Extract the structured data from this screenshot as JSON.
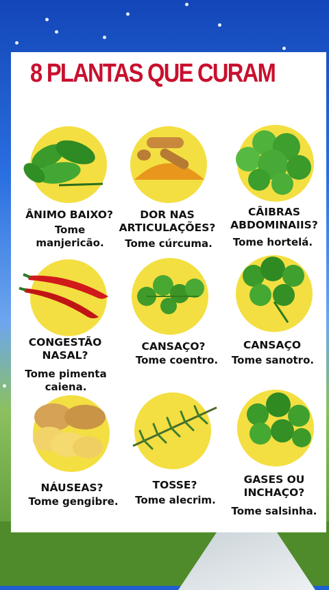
{
  "title": "8 PLANTAS QUE CURAM",
  "items": [
    {
      "question": "ÂNIMO BAIXO?",
      "answer": [
        "Tome",
        "manjericão."
      ],
      "icon": "basil-icon"
    },
    {
      "question": "DOR NAS ARTICULAÇÕES?",
      "answer": [
        "Tome cúrcuma."
      ],
      "icon": "turmeric-icon"
    },
    {
      "question": "CÂIBRAS ABDOMINAIIS?",
      "answer": [
        "Tome hortelá."
      ],
      "icon": "mint-icon"
    },
    {
      "question": "CONGESTÃO NASAL?",
      "answer": [
        "Tome pimenta",
        "caiena."
      ],
      "icon": "cayenne-pepper-icon"
    },
    {
      "question": "CANSAÇO?",
      "answer": [
        "Tome coentro."
      ],
      "icon": "coriander-icon"
    },
    {
      "question": "CANSAÇO",
      "answer": [
        "Tome sanotro."
      ],
      "icon": "parsley-icon"
    },
    {
      "question": "NÁUSEAS?",
      "answer": [
        "Tome gengibre."
      ],
      "icon": "ginger-icon"
    },
    {
      "question": "TOSSE?",
      "answer": [
        "Tome alecrim."
      ],
      "icon": "rosemary-icon"
    },
    {
      "question": "GASES OU INCHAÇO?",
      "answer": [
        "Tome salsinha."
      ],
      "icon": "parsley-icon"
    }
  ],
  "colors": {
    "title": "#c8102e",
    "circle": "#f3df42",
    "leaf": "#3a9a2a",
    "pepper": "#d11a1a"
  }
}
